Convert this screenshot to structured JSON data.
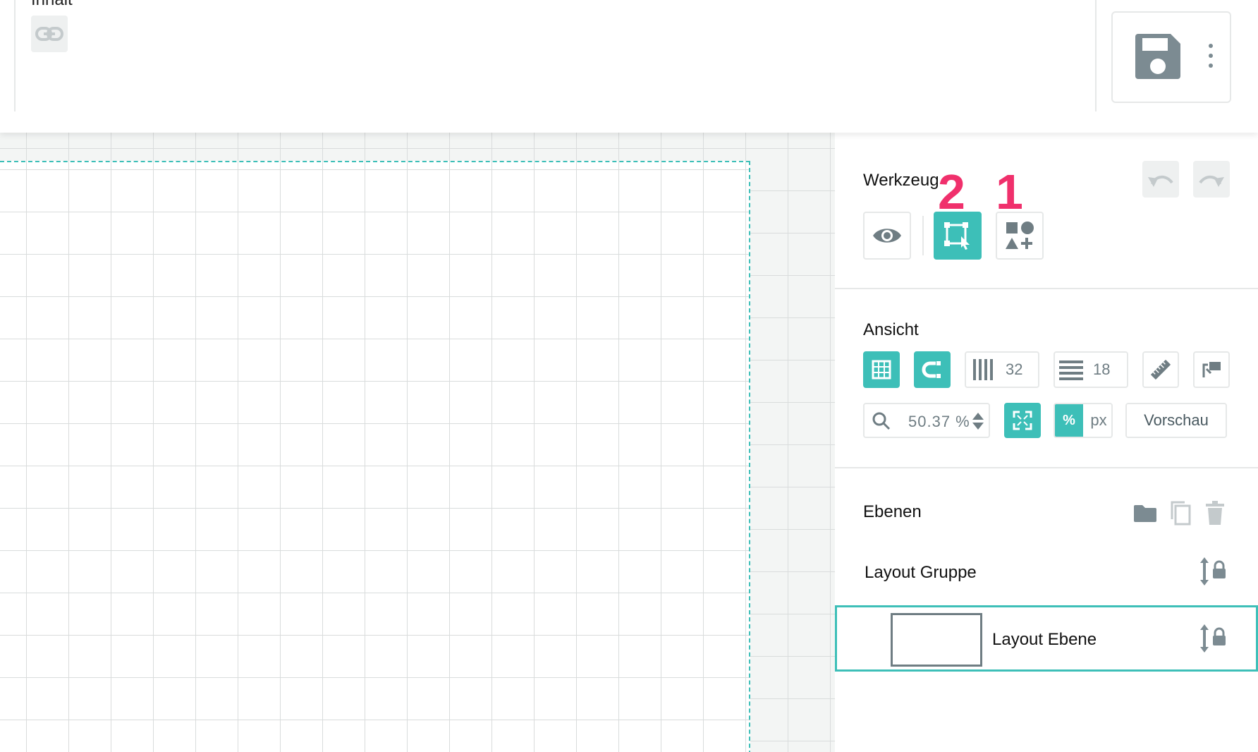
{
  "topbar": {
    "cut_title": "Inhalt",
    "link_icon": "link-icon",
    "save_icon": "floppy-disk-icon",
    "more_icon": "kebab-menu-icon"
  },
  "panel": {
    "tools": {
      "title": "Werkzeuge",
      "buttons": [
        "eye-icon",
        "select-transform-icon",
        "shapes-add-icon"
      ],
      "undo_icon": "undo-icon",
      "redo_icon": "redo-icon"
    },
    "view": {
      "title": "Ansicht",
      "columns_value": "32",
      "rows_value": "18",
      "zoom_value": "50.37 %",
      "unit_percent": "%",
      "unit_px": "px",
      "preview_label": "Vorschau"
    },
    "layers": {
      "title": "Ebenen",
      "items": [
        {
          "label": "Layout Gruppe",
          "selected": false
        },
        {
          "label": "Layout Ebene",
          "selected": true
        }
      ]
    }
  },
  "annotations": {
    "badge_1": "1",
    "badge_2": "2"
  },
  "colors": {
    "accent": "#3dbfb8",
    "icon_grey": "#7c8b92",
    "badge": "#f0306c"
  }
}
